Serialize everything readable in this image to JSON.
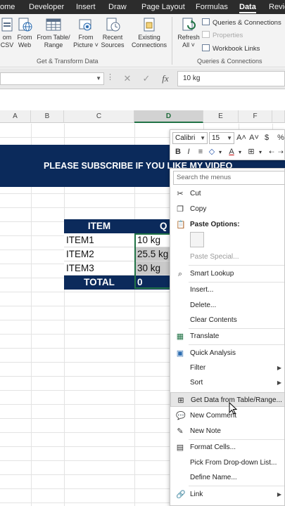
{
  "ribbon_tabs": [
    "ome",
    "Developer",
    "Insert",
    "Draw",
    "Page Layout",
    "Formulas",
    "Data",
    "Revie"
  ],
  "active_tab": "Data",
  "ribbon": {
    "get_transform": {
      "buttons": [
        {
          "line1": "om",
          "line2": "CSV"
        },
        {
          "line1": "From",
          "line2": "Web"
        },
        {
          "line1": "From Table/",
          "line2": "Range"
        },
        {
          "line1": "From",
          "line2": "Picture ˅"
        },
        {
          "line1": "Recent",
          "line2": "Sources"
        },
        {
          "line1": "Existing",
          "line2": "Connections"
        }
      ],
      "label": "Get & Transform Data"
    },
    "queries": {
      "refresh": {
        "line1": "Refresh",
        "line2": "All ˅"
      },
      "items": [
        "Queries & Connections",
        "Properties",
        "Workbook Links"
      ],
      "label": "Queries & Connections"
    }
  },
  "formula_bar": {
    "cancel": "✕",
    "enter": "✓",
    "fx": "fx",
    "value": "10 kg"
  },
  "columns": [
    "A",
    "B",
    "C",
    "D",
    "E",
    "F"
  ],
  "selected_column": "D",
  "sheet": {
    "banner": "PLEASE SUBSCRIBE IF YOU LIKE MY VIDEO",
    "header": {
      "item": "ITEM",
      "qty": "Q"
    },
    "rows": [
      {
        "item": "ITEM1",
        "qty": "10 kg"
      },
      {
        "item": "ITEM2",
        "qty": "25.5 kg"
      },
      {
        "item": "ITEM3",
        "qty": "30 kg"
      }
    ],
    "total": {
      "label": "TOTAL",
      "value": "0"
    }
  },
  "mini_toolbar": {
    "font": "Calibri",
    "size": "15",
    "grow": "A˄",
    "shrink": "A˅",
    "currency": "$",
    "percent": "%",
    "bold": "B",
    "italic": "I"
  },
  "context_menu": {
    "search_placeholder": "Search the menus",
    "items": {
      "cut": "Cut",
      "copy": "Copy",
      "paste_options": "Paste Options:",
      "paste_special": "Paste Special...",
      "smart_lookup": "Smart Lookup",
      "insert": "Insert...",
      "delete": "Delete...",
      "clear_contents": "Clear Contents",
      "translate": "Translate",
      "quick_analysis": "Quick Analysis",
      "filter": "Filter",
      "sort": "Sort",
      "get_data": "Get Data from Table/Range...",
      "new_comment": "New Comment",
      "new_note": "New Note",
      "format_cells": "Format Cells...",
      "pick_from_dropdown": "Pick From Drop-down List...",
      "define_name": "Define Name...",
      "link": "Link"
    }
  },
  "colors": {
    "banner_bg": "#0b2a5b",
    "selection": "#217346",
    "tab_bar": "#2c2c2c"
  }
}
